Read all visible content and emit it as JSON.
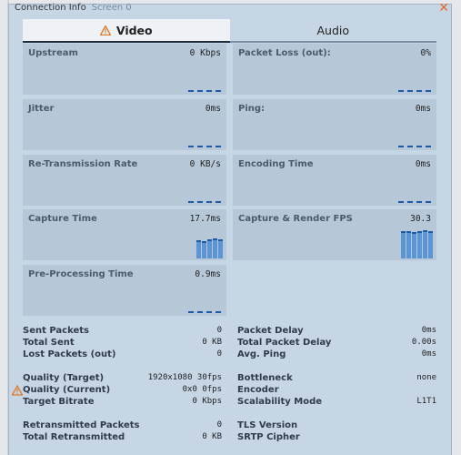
{
  "window": {
    "title": "Connection Info",
    "subtitle": "Screen 0"
  },
  "tabs": [
    {
      "label": "Video"
    },
    {
      "label": "Audio"
    }
  ],
  "graphs": [
    {
      "label": "Upstream",
      "value": "0 Kbps"
    },
    {
      "label": "Packet Loss (out):",
      "value": "0%"
    },
    {
      "label": "Jitter",
      "value": "0ms"
    },
    {
      "label": "Ping:",
      "value": "0ms"
    },
    {
      "label": "Re-Transmission Rate",
      "value": "0 KB/s"
    },
    {
      "label": "Encoding Time",
      "value": "0ms"
    },
    {
      "label": "Capture Time",
      "value": "17.7ms"
    },
    {
      "label": "Capture & Render FPS",
      "value": "30.3"
    },
    {
      "label": "Pre-Processing Time",
      "value": "0.9ms"
    }
  ],
  "left_stats": [
    {
      "label": "Sent Packets",
      "value": "0"
    },
    {
      "label": "Total Sent",
      "value": "0 KB"
    },
    {
      "label": "Lost Packets (out)",
      "value": "0"
    },
    {
      "label": "Quality (Target)",
      "value": "1920x1080 30fps"
    },
    {
      "label": "Quality (Current)",
      "value": "0x0 0fps"
    },
    {
      "label": "Target Bitrate",
      "value": "0 Kbps"
    },
    {
      "label": "Retransmitted Packets",
      "value": "0"
    },
    {
      "label": "Total Retransmitted",
      "value": "0 KB"
    }
  ],
  "right_stats": [
    {
      "label": "Packet Delay",
      "value": "0ms"
    },
    {
      "label": "Total Packet Delay",
      "value": "0.00s"
    },
    {
      "label": "Avg. Ping",
      "value": "0ms"
    },
    {
      "label": "Bottleneck",
      "value": "none"
    },
    {
      "label": "Encoder",
      "value": ""
    },
    {
      "label": "Scalability Mode",
      "value": "L1T1"
    },
    {
      "label": "TLS Version",
      "value": ""
    },
    {
      "label": "SRTP Cipher",
      "value": ""
    }
  ],
  "colors": {
    "panel": "#c7d6e5",
    "graph_bg": "#b6c7d8",
    "bar": "#5b95d6",
    "warning": "#e07a2a"
  }
}
